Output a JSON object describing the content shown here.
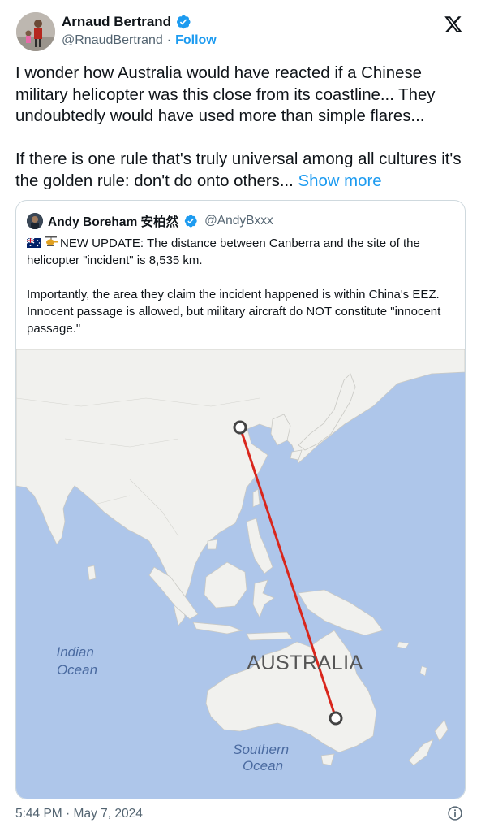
{
  "author": {
    "name": "Arnaud Bertrand",
    "handle": "@RnaudBertrand",
    "follow_label": "Follow",
    "separator": "·"
  },
  "tweet": {
    "text": "I wonder how Australia would have reacted if a Chinese military helicopter was this close from its coastline... They undoubtedly would have used more than simple flares...\n\nIf there is one rule that's truly universal among all cultures it's the golden rule: don't do onto others... ",
    "show_more_label": "Show more"
  },
  "quote": {
    "name": "Andy Boreham 安柏然",
    "handle": "@AndyBxxx",
    "icons": [
      "australia-flag-icon",
      "helicopter-icon"
    ],
    "text": "NEW UPDATE: The distance between Canberra and the site of the helicopter \"incident\" is 8,535 km.\n\nImportantly, the area they claim the incident happened is within China's EEZ. Innocent passage is allowed, but military aircraft do NOT constitute \"innocent passage.\"",
    "map": {
      "labels": {
        "ocean_indian": "Indian\nOcean",
        "ocean_southern": "Southern\nOcean",
        "country": "AUSTRALIA"
      },
      "colors": {
        "water": "#aec6ea",
        "land": "#f1f1ee",
        "route": "#d9261c",
        "ocean_text": "#4a6aa0"
      }
    }
  },
  "footer": {
    "time": "5:44 PM",
    "separator": "·",
    "date": "May 7, 2024"
  },
  "colors": {
    "link": "#1d9bf0",
    "verified": "#1d9bf0",
    "muted": "#536471"
  }
}
